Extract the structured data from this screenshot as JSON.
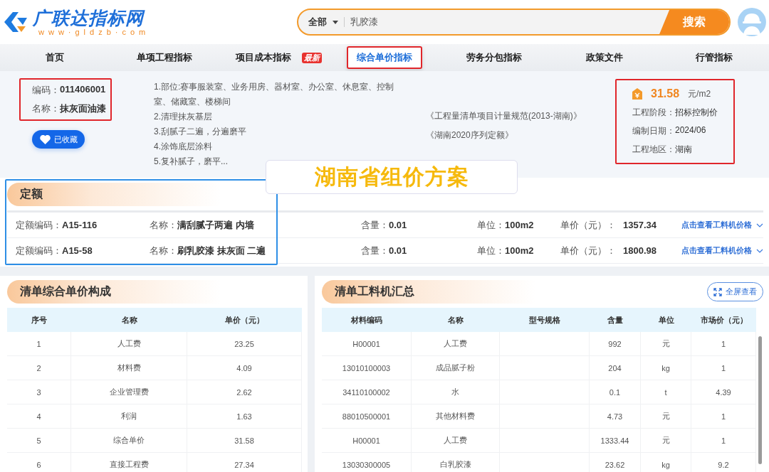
{
  "logo": {
    "name": "广联达指标网",
    "url": "www·gldzb·com"
  },
  "search": {
    "scope": "全部",
    "value": "乳胶漆",
    "button": "搜索"
  },
  "nav": [
    {
      "label": "首页",
      "selected": false
    },
    {
      "label": "单项工程指标",
      "selected": false
    },
    {
      "label": "项目成本指标",
      "selected": false,
      "badge": "最新"
    },
    {
      "label": "综合单价指标",
      "selected": true
    },
    {
      "label": "劳务分包指标",
      "selected": false
    },
    {
      "label": "政策文件",
      "selected": false
    },
    {
      "label": "行管指标",
      "selected": false
    }
  ],
  "item": {
    "highlighted": true,
    "fields": [
      {
        "label": "编码：",
        "value": "011406001"
      },
      {
        "label": "名称：",
        "value": "抹灰面油漆"
      }
    ],
    "favorite": {
      "label": "已收藏",
      "on": true
    },
    "features": [
      "1.部位:赛事服装室、业务用房、器材室、办公室、休息室、控制室、储藏室、楼梯间",
      "2.清理抹灰基层",
      "3.刮腻子二遍，分遍磨平",
      "4.涂饰底层涂料",
      "5.复补腻子，磨平..."
    ],
    "standards": [
      "《工程量清单项目计量规范(2013-湖南)》",
      "《湖南2020序列定额》"
    ]
  },
  "price": {
    "highlighted": true,
    "value": "31.58",
    "unit": "元/m2",
    "fields": [
      {
        "label": "工程阶段：",
        "value": "招标控制价"
      },
      {
        "label": "编制日期：",
        "value": "2024/06"
      },
      {
        "label": "工程地区：",
        "value": "湖南"
      }
    ]
  },
  "callout": "湖南省组价方案",
  "quota": {
    "title": "定额",
    "highlighted": true,
    "rows": [
      {
        "code_label": "定额编码：",
        "code": "A15-116",
        "name_label": "名称：",
        "name": "满刮腻子两遍 内墙",
        "amount_label": "含量：",
        "amount": "0.01",
        "unit_label": "单位：",
        "unit": "100m2",
        "price_label": "单价（元）：",
        "price": "1357.34",
        "link": "点击查看工料机价格"
      },
      {
        "code_label": "定额编码：",
        "code": "A15-58",
        "name_label": "名称：",
        "name": "刷乳胶漆 抹灰面 二遍",
        "amount_label": "含量：",
        "amount": "0.01",
        "unit_label": "单位：",
        "unit": "100m2",
        "price_label": "单价（元）：",
        "price": "1800.98",
        "link": "点击查看工料机价格"
      }
    ]
  },
  "composition": {
    "title": "清单综合单价构成",
    "columns": [
      "序号",
      "名称",
      "单价（元）"
    ],
    "rows": [
      [
        "1",
        "人工费",
        "23.25"
      ],
      [
        "2",
        "材料费",
        "4.09"
      ],
      [
        "3",
        "企业管理费",
        "2.62"
      ],
      [
        "4",
        "利润",
        "1.63"
      ],
      [
        "5",
        "综合单价",
        "31.58"
      ],
      [
        "6",
        "直接工程费",
        "27.34"
      ]
    ]
  },
  "materials": {
    "title": "清单工料机汇总",
    "fullscreen": "全屏查看",
    "columns": [
      "材料编码",
      "名称",
      "型号规格",
      "含量",
      "单位",
      "市场价（元）"
    ],
    "rows": [
      {
        "code": "H00001",
        "name": "人工费",
        "amount": "992",
        "unit": "元",
        "price": "1"
      },
      {
        "code": "13010100003",
        "name": "成品腻子粉",
        "amount": "204",
        "unit": "kg",
        "price": "1"
      },
      {
        "code": "34110100002",
        "name": "水",
        "amount": "0.1",
        "unit": "t",
        "price": "4.39"
      },
      {
        "code": "88010500001",
        "name": "其他材料费",
        "amount": "4.73",
        "unit": "元",
        "price": "1"
      },
      {
        "code": "H00001",
        "name": "人工费",
        "amount": "1333.44",
        "unit": "元",
        "price": "1"
      },
      {
        "code": "13030300005",
        "name": "白乳胶漆",
        "amount": "23.62",
        "unit": "kg",
        "price": "9.2"
      }
    ]
  }
}
